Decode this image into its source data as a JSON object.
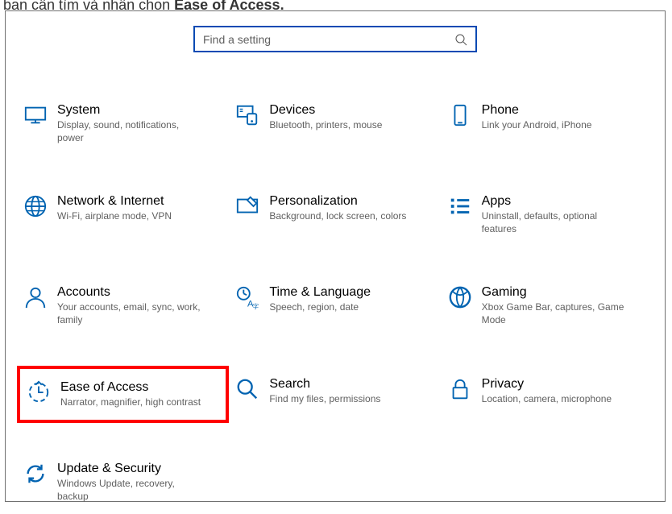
{
  "header_fragment": "bạn cần tìm và nhấn chọn",
  "header_bold": "Ease of Access.",
  "search": {
    "placeholder": "Find a setting"
  },
  "categories": [
    {
      "key": "system",
      "title": "System",
      "desc": "Display, sound, notifications, power",
      "icon": "system-icon"
    },
    {
      "key": "devices",
      "title": "Devices",
      "desc": "Bluetooth, printers, mouse",
      "icon": "devices-icon"
    },
    {
      "key": "phone",
      "title": "Phone",
      "desc": "Link your Android, iPhone",
      "icon": "phone-icon"
    },
    {
      "key": "network",
      "title": "Network & Internet",
      "desc": "Wi-Fi, airplane mode, VPN",
      "icon": "network-icon"
    },
    {
      "key": "personal",
      "title": "Personalization",
      "desc": "Background, lock screen, colors",
      "icon": "personalization-icon"
    },
    {
      "key": "apps",
      "title": "Apps",
      "desc": "Uninstall, defaults, optional features",
      "icon": "apps-icon"
    },
    {
      "key": "accounts",
      "title": "Accounts",
      "desc": "Your accounts, email, sync, work, family",
      "icon": "accounts-icon"
    },
    {
      "key": "time",
      "title": "Time & Language",
      "desc": "Speech, region, date",
      "icon": "time-icon"
    },
    {
      "key": "gaming",
      "title": "Gaming",
      "desc": "Xbox Game Bar, captures, Game Mode",
      "icon": "gaming-icon"
    },
    {
      "key": "ease",
      "title": "Ease of Access",
      "desc": "Narrator, magnifier, high contrast",
      "icon": "ease-icon",
      "highlight": true
    },
    {
      "key": "search",
      "title": "Search",
      "desc": "Find my files, permissions",
      "icon": "search-cat-icon"
    },
    {
      "key": "privacy",
      "title": "Privacy",
      "desc": "Location, camera, microphone",
      "icon": "privacy-icon"
    },
    {
      "key": "update",
      "title": "Update & Security",
      "desc": "Windows Update, recovery, backup",
      "icon": "update-icon"
    }
  ]
}
